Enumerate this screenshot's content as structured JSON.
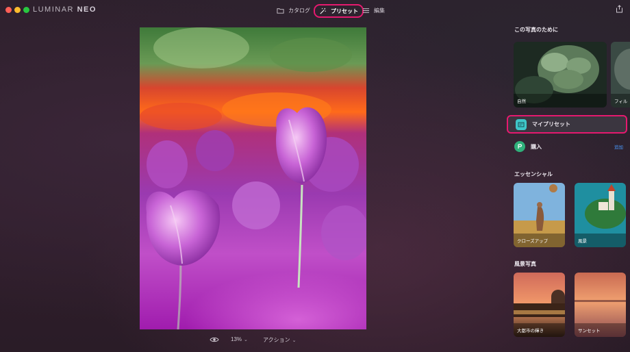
{
  "app": {
    "logo_text": "LUMINAR",
    "logo_suffix": "NEO"
  },
  "nav": {
    "catalog": "カタログ",
    "presets": "プリセット",
    "edit": "編集"
  },
  "bottom_bar": {
    "zoom": "13%",
    "actions": "アクション"
  },
  "panel": {
    "for_this_photo": {
      "title": "この写真のために",
      "cards": [
        {
          "label": "自然"
        },
        {
          "label": "フィル"
        }
      ]
    },
    "my_presets": {
      "label": "マイプリセット"
    },
    "buy": {
      "label": "購入",
      "action": "追加"
    },
    "essentials": {
      "title": "エッセンシャル",
      "cards": [
        {
          "label": "クローズアップ"
        },
        {
          "label": "風景"
        }
      ]
    },
    "landscape": {
      "title": "風景写真",
      "cards": [
        {
          "label": "大都市の輝き"
        },
        {
          "label": "サンセット"
        }
      ]
    }
  },
  "colors": {
    "accent": "#e6196f",
    "link": "#4a9bff"
  }
}
